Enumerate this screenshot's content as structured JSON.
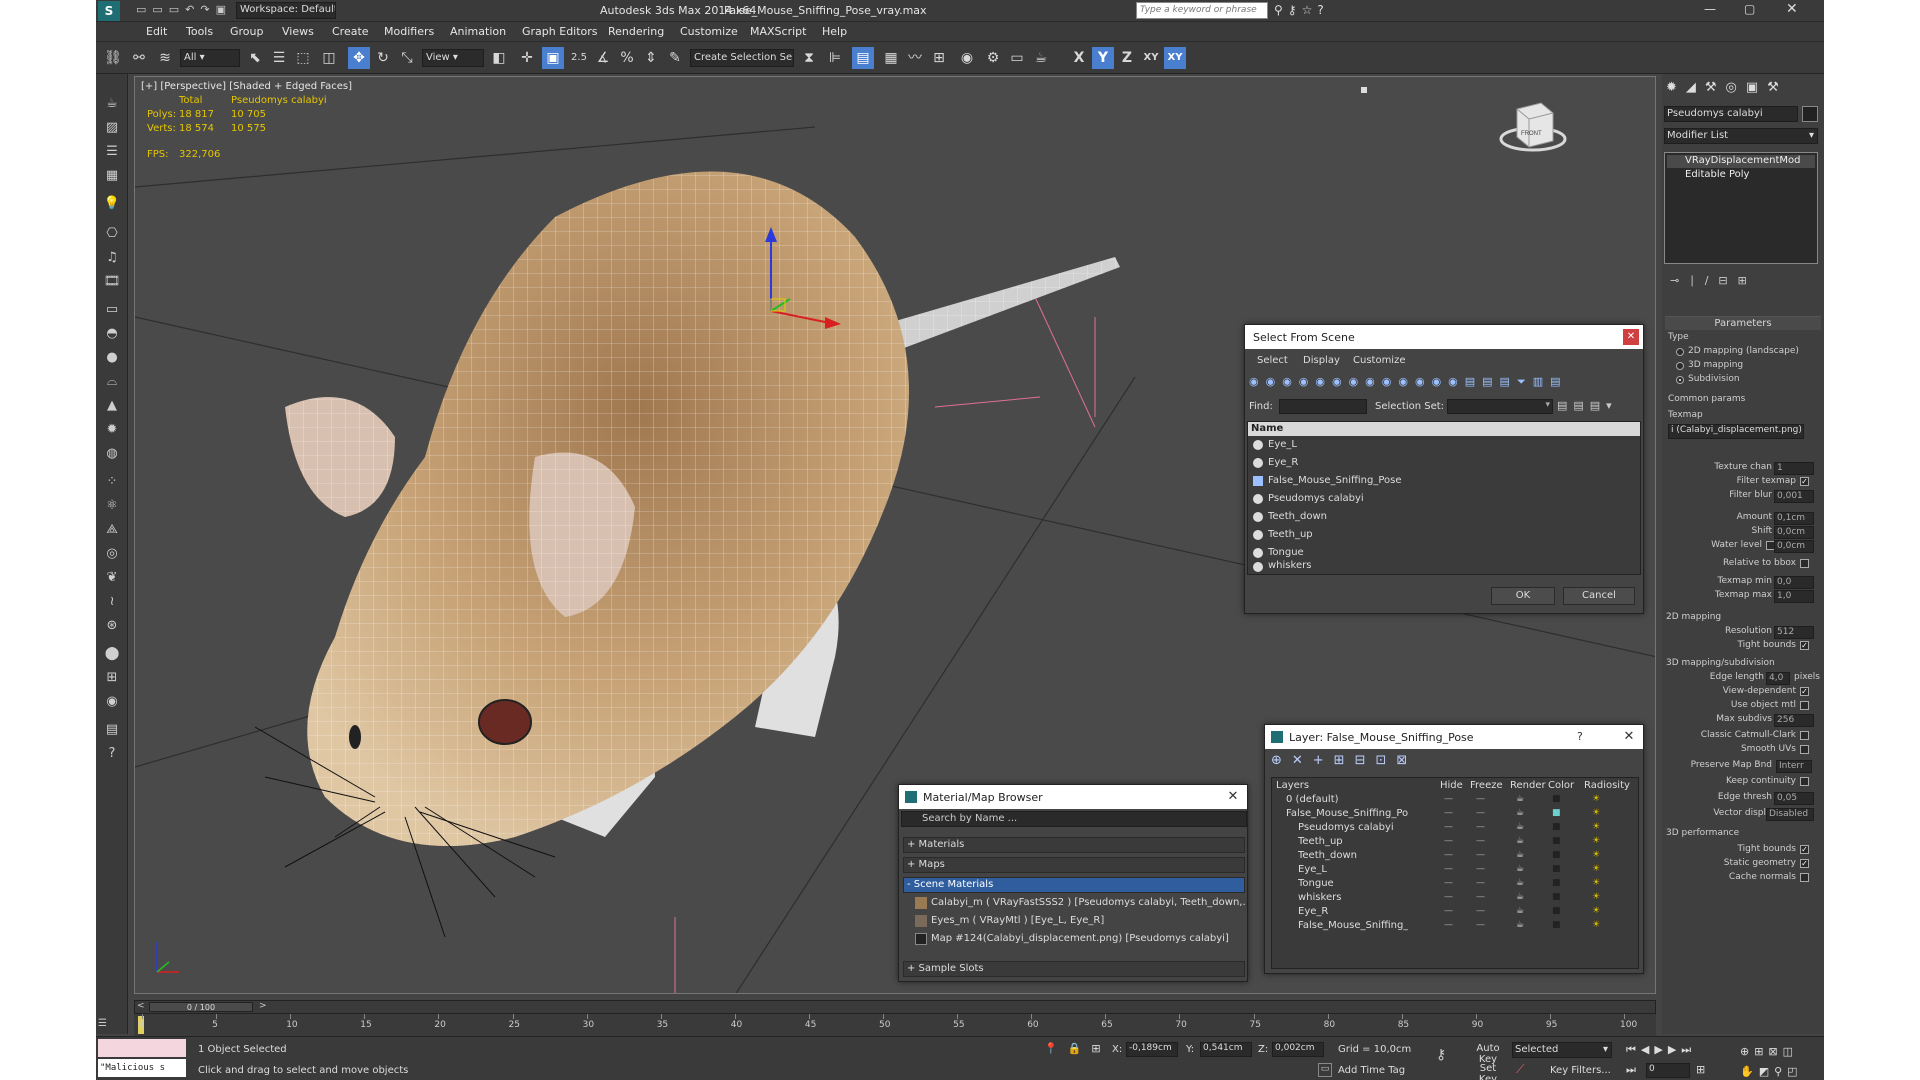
{
  "titlebar": {
    "workspace": "Workspace: Default",
    "app_title": "Autodesk 3ds Max  2014 x64",
    "file": "False_Mouse_Sniffing_Pose_vray.max",
    "search_placeholder": "Type a keyword or phrase"
  },
  "menu": [
    "Edit",
    "Tools",
    "Group",
    "Views",
    "Create",
    "Modifiers",
    "Animation",
    "Graph Editors",
    "Rendering",
    "Customize",
    "MAXScript",
    "Help"
  ],
  "toolbar": {
    "filter": "All",
    "refcoord": "View",
    "selset": "Create Selection Se",
    "axes": [
      "X",
      "Y",
      "Z",
      "XY",
      "XY"
    ],
    "snap_labels": [
      "2.5",
      "%"
    ]
  },
  "viewport": {
    "label": "[+] [Perspective] [Shaded + Edged Faces]",
    "stats": {
      "total": "Total",
      "object": "Pseudomys calabyi",
      "polys_label": "Polys:",
      "polys_total": "18 817",
      "polys_obj": "10 705",
      "verts_label": "Verts:",
      "verts_total": "18 574",
      "verts_obj": "10 575",
      "fps_label": "FPS:",
      "fps": "322,706"
    },
    "viewcube": "FRONT"
  },
  "select_dialog": {
    "title": "Select From Scene",
    "menus": [
      "Select",
      "Display",
      "Customize"
    ],
    "find_label": "Find:",
    "selset_label": "Selection Set:",
    "col_name": "Name",
    "items": [
      "Eye_L",
      "Eye_R",
      "False_Mouse_Sniffing_Pose",
      "Pseudomys calabyi",
      "Teeth_down",
      "Teeth_up",
      "Tongue",
      "whiskers"
    ],
    "ok": "OK",
    "cancel": "Cancel"
  },
  "layer_dialog": {
    "title": "Layer: False_Mouse_Sniffing_Pose",
    "help": "?",
    "cols": [
      "Layers",
      "Hide",
      "Freeze",
      "Render",
      "Color",
      "Radiosity"
    ],
    "rows": [
      "0 (default)",
      "False_Mouse_Sniffing_Po",
      "Pseudomys calabyi",
      "Teeth_up",
      "Teeth_down",
      "Eye_L",
      "Tongue",
      "whiskers",
      "Eye_R",
      "False_Mouse_Sniffing_"
    ]
  },
  "mat_browser": {
    "title": "Material/Map Browser",
    "search": "Search by Name ...",
    "groups": [
      "+ Materials",
      "+ Maps",
      "- Scene Materials"
    ],
    "items": [
      "Calabyi_m  ( VRayFastSSS2 ) [Pseudomys calabyi, Teeth_down,...",
      "Eyes_m  ( VRayMtl ) [Eye_L, Eye_R]",
      "Map #124(Calabyi_displacement.png) [Pseudomys calabyi]"
    ],
    "footer": "+ Sample Slots"
  },
  "cmdpanel": {
    "object_name": "Pseudomys calabyi",
    "modifier_list": "Modifier List",
    "stack": [
      "VRayDisplacementMod",
      "Editable Poly"
    ],
    "params_title": "Parameters",
    "type_label": "Type",
    "types": [
      "2D mapping (landscape)",
      "3D mapping",
      "Subdivision"
    ],
    "common": "Common params",
    "texmap_label": "Texmap",
    "texmap": "i (Calabyi_displacement.png)",
    "texture_chan": "Texture chan",
    "texture_chan_v": "1",
    "filter_texmap": "Filter texmap",
    "filter_blur": "Filter blur",
    "filter_blur_v": "0,001",
    "amount": "Amount",
    "amount_v": "0,1cm",
    "shift": "Shift",
    "shift_v": "0,0cm",
    "water": "Water level",
    "water_v": "0,0cm",
    "relbbox": "Relative to bbox",
    "tmin": "Texmap min",
    "tmin_v": "0,0",
    "tmax": "Texmap max",
    "tmax_v": "1,0",
    "map2d": "2D mapping",
    "res": "Resolution",
    "res_v": "512",
    "tight": "Tight bounds",
    "map3d": "3D mapping/subdivision",
    "edge": "Edge length",
    "edge_v": "4,0",
    "pixels": "pixels",
    "viewdep": "View-dependent",
    "useobj": "Use object mtl",
    "maxsub": "Max subdivs",
    "maxsub_v": "256",
    "catmull": "Classic Catmull-Clark",
    "smoothuv": "Smooth UVs",
    "preserve": "Preserve Map Bnd",
    "preserve_v": "Interr",
    "keepcont": "Keep continuity",
    "edgethr": "Edge thresh",
    "edgethr_v": "0,05",
    "vecdisp": "Vector displ",
    "vecdisp_v": "Disabled",
    "perf": "3D performance",
    "tight2": "Tight bounds",
    "static": "Static geometry",
    "cache": "Cache normals"
  },
  "timeline": {
    "frame": "0 / 100",
    "ticks": [
      "0",
      "5",
      "10",
      "15",
      "20",
      "25",
      "30",
      "35",
      "40",
      "45",
      "50",
      "55",
      "60",
      "65",
      "70",
      "75",
      "80",
      "85",
      "90",
      "95",
      "100"
    ]
  },
  "status": {
    "script": "\"Malicious s",
    "selected": "1 Object Selected",
    "hint": "Click and drag to select and move objects",
    "x_label": "X:",
    "x": "-0,189cm",
    "y_label": "Y:",
    "y": "0,541cm",
    "z_label": "Z:",
    "z": "0,002cm",
    "grid": "Grid = 10,0cm",
    "autokey": "Auto Key",
    "setkey": "Set Key",
    "sel_dd": "Selected",
    "keyfilters": "Key Filters...",
    "addtag": "Add Time Tag",
    "frame_field": "0"
  }
}
